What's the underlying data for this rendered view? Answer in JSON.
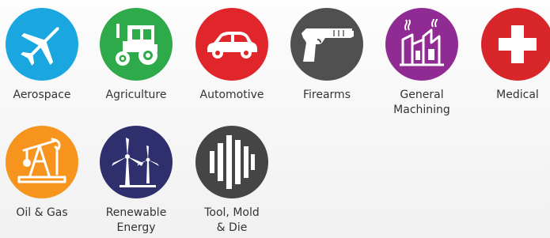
{
  "industries": [
    {
      "label": "Aerospace",
      "icon": "airplane-icon",
      "color": "#1aa7e0"
    },
    {
      "label": "Agriculture",
      "icon": "tractor-icon",
      "color": "#2eaa4a"
    },
    {
      "label": "Automotive",
      "icon": "car-icon",
      "color": "#e0252b"
    },
    {
      "label": "Firearms",
      "icon": "pistol-icon",
      "color": "#505050"
    },
    {
      "label": "General\nMachining",
      "icon": "factory-icon",
      "color": "#8f2b92"
    },
    {
      "label": "Medical",
      "icon": "medical-cross-icon",
      "color": "#d8262b"
    },
    {
      "label": "Oil & Gas",
      "icon": "oil-pump-icon",
      "color": "#f7941d"
    },
    {
      "label": "Renewable\nEnergy",
      "icon": "wind-turbine-icon",
      "color": "#2f2f6e"
    },
    {
      "label": "Tool, Mold\n& Die",
      "icon": "tool-bars-icon",
      "color": "#454545"
    }
  ]
}
